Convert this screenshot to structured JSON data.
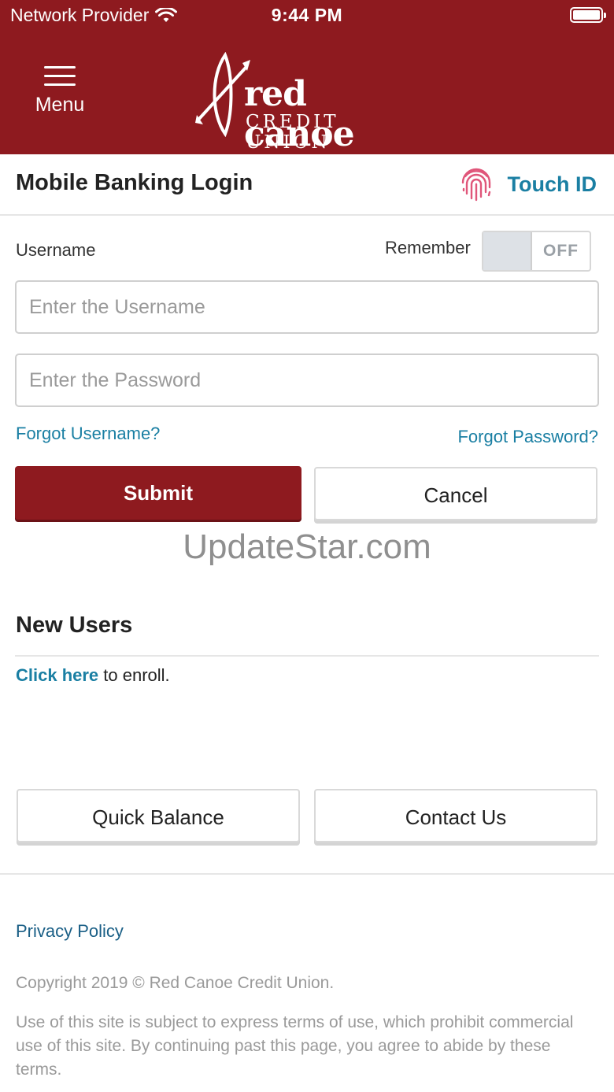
{
  "status_bar": {
    "carrier": "Network Provider",
    "time": "9:44 PM",
    "wifi_icon": "wifi-icon",
    "battery_icon": "battery-icon"
  },
  "header": {
    "menu_label": "Menu",
    "menu_icon": "hamburger-icon",
    "logo_line1": "red canoe",
    "logo_line2": "CREDIT UNION",
    "brand_color": "#8e1a1f"
  },
  "login": {
    "title": "Mobile Banking Login",
    "touch_id_label": "Touch ID",
    "touch_id_icon": "fingerprint-icon",
    "username_label": "Username",
    "remember_label": "Remember",
    "remember_state": "OFF",
    "username_placeholder": "Enter the Username",
    "password_placeholder": "Enter the Password",
    "forgot_username": "Forgot Username?",
    "forgot_password": "Forgot Password?",
    "submit_label": "Submit",
    "cancel_label": "Cancel",
    "link_color": "#1a7fa3"
  },
  "watermark": "UpdateStar.com",
  "new_users": {
    "title": "New Users",
    "enroll_link": "Click here",
    "enroll_text": " to enroll."
  },
  "actions": {
    "quick_balance": "Quick Balance",
    "contact_us": "Contact Us"
  },
  "footer": {
    "privacy_policy": "Privacy Policy",
    "copyright": "Copyright 2019 © Red Canoe Credit Union.",
    "terms": "Use of this site is subject to express terms of use, which prohibit commercial use of this site. By continuing past this page, you agree to abide by these terms."
  }
}
